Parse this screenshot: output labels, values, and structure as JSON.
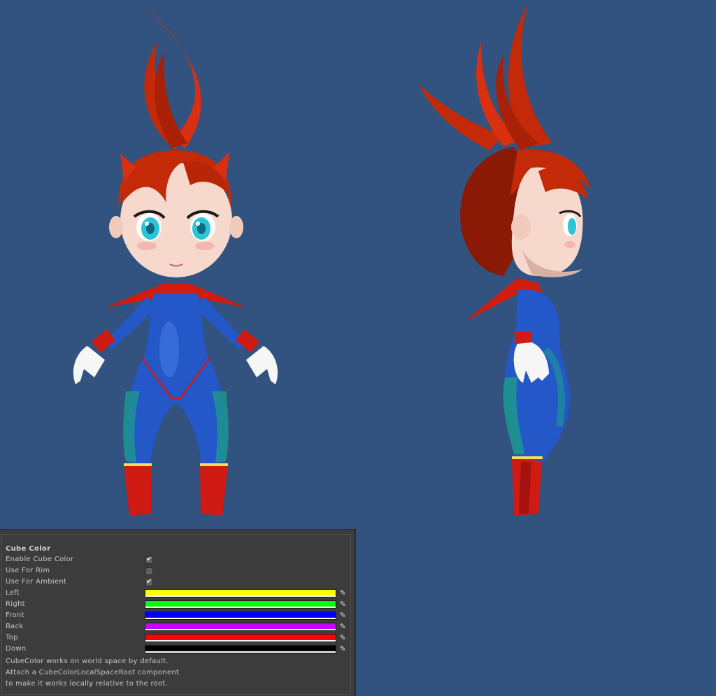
{
  "panel": {
    "title": "Cube Color",
    "toggles": [
      {
        "label": "Enable Cube Color",
        "checked": true
      },
      {
        "label": "Use For Rim",
        "checked": false
      },
      {
        "label": "Use For Ambient",
        "checked": true
      }
    ],
    "colors": [
      {
        "label": "Left",
        "hex": "#ffff00"
      },
      {
        "label": "Right",
        "hex": "#00ff00"
      },
      {
        "label": "Front",
        "hex": "#0000ff"
      },
      {
        "label": "Back",
        "hex": "#c800ff"
      },
      {
        "label": "Top",
        "hex": "#ff0000"
      },
      {
        "label": "Down",
        "hex": "#000000"
      }
    ],
    "picker_icon": "eyedropper-icon",
    "check_glyph": "✔",
    "picker_glyph": "✎",
    "notes": [
      "CubeColor works on world space by default.",
      "Attach a CubeColorLocalSpaceRoot component",
      "to make it works locally relative to the root."
    ]
  },
  "scene": {
    "background": "#32527f",
    "hair": "#c42a08",
    "hair_dark": "#8a1a06",
    "skin": "#f6d8cc",
    "suit": "#2457c8",
    "suit_rim": "#1d9a8c",
    "cape": "#d21c10",
    "boots": "#d01a14",
    "gloves": "#f6f6f6",
    "eyes": "#2cc4d6"
  }
}
